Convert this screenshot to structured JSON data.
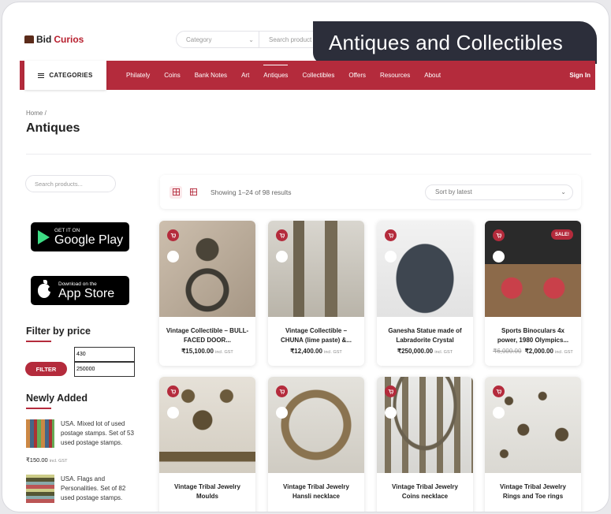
{
  "logo": {
    "main": "Bid",
    "accent": "Curios"
  },
  "search": {
    "category_placeholder": "Category",
    "query_placeholder": "Search product"
  },
  "banner": "Antiques and Collectibles",
  "nav": {
    "categories_label": "CATEGORIES",
    "items": [
      "Philately",
      "Coins",
      "Bank Notes",
      "Art",
      "Antiques",
      "Collectibles",
      "Offers",
      "Resources",
      "About"
    ],
    "active": "Antiques",
    "sign_in": "Sign In"
  },
  "breadcrumb": {
    "home": "Home",
    "sep": "/"
  },
  "page_title": "Antiques",
  "sidebar": {
    "search_placeholder": "Search products...",
    "google_play": {
      "line1": "GET IT ON",
      "line2": "Google Play"
    },
    "app_store": {
      "line1": "Download on the",
      "line2": "App Store"
    },
    "filter_heading": "Filter by price",
    "price_min": "430",
    "price_max": "250000",
    "filter_button": "FILTER",
    "newly_heading": "Newly Added",
    "newly_items": [
      {
        "text": "USA. Mixed lot of used postage stamps. Set of 53 used postage stamps.",
        "price": "₹150.00",
        "gst": "incl. GST"
      },
      {
        "text": "USA. Flags and Personalities. Set of 82 used postage stamps.",
        "price": "",
        "gst": ""
      }
    ]
  },
  "toolbar": {
    "showing": "Showing 1–24 of 98 results",
    "sort": "Sort by latest"
  },
  "products": [
    {
      "title": "Vintage Collectible – BULL-FACED DOOR...",
      "price": "₹15,100.00",
      "old_price": "",
      "gst": "incl. GST",
      "sale": ""
    },
    {
      "title": "Vintage Collectible – CHUNA (lime paste) &...",
      "price": "₹12,400.00",
      "old_price": "",
      "gst": "incl. GST",
      "sale": ""
    },
    {
      "title": "Ganesha Statue made of Labradorite Crystal",
      "price": "₹250,000.00",
      "old_price": "",
      "gst": "incl. GST",
      "sale": ""
    },
    {
      "title": "Sports Binoculars 4x power, 1980 Olympics...",
      "price": "₹2,000.00",
      "old_price": "₹6,000.00",
      "gst": "incl. GST",
      "sale": "SALE!"
    },
    {
      "title": "Vintage Tribal Jewelry Moulds",
      "price": "",
      "old_price": "",
      "gst": "",
      "sale": ""
    },
    {
      "title": "Vintage Tribal Jewelry Hansli necklace",
      "price": "",
      "old_price": "",
      "gst": "",
      "sale": ""
    },
    {
      "title": "Vintage Tribal Jewelry Coins necklace",
      "price": "",
      "old_price": "",
      "gst": "",
      "sale": ""
    },
    {
      "title": "Vintage Tribal Jewelry Rings and Toe rings",
      "price": "",
      "old_price": "",
      "gst": "",
      "sale": ""
    }
  ],
  "icons": {
    "cart": "cart-icon",
    "grid": "grid-view-icon",
    "list": "list-view-icon"
  },
  "colors": {
    "brand": "#b42b3c",
    "banner": "#2c2e3a"
  }
}
